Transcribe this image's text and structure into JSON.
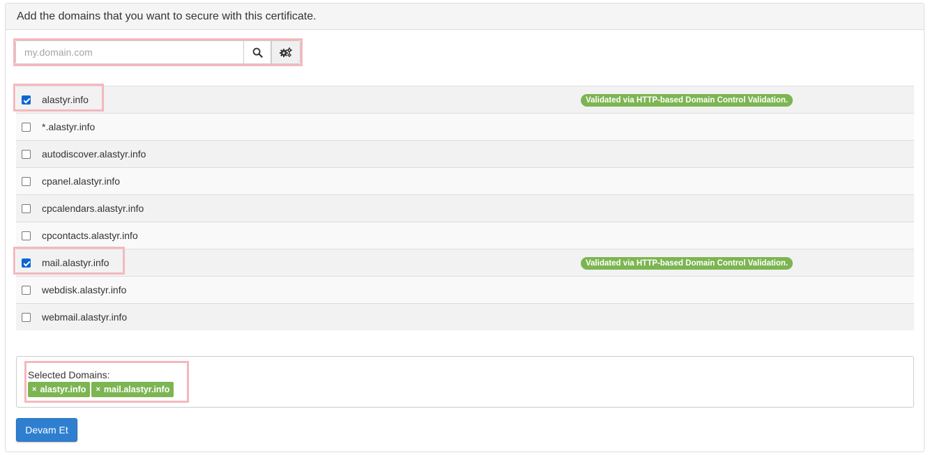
{
  "header": {
    "title": "Add the domains that you want to secure with this certificate."
  },
  "search": {
    "placeholder": "my.domain.com",
    "value": "",
    "search_icon": "search-icon",
    "settings_icon": "gears-icon"
  },
  "domains": [
    {
      "name": "alastyr.info",
      "checked": true,
      "validation": "Validated via HTTP-based Domain Control Validation."
    },
    {
      "name": "*.alastyr.info",
      "checked": false,
      "validation": ""
    },
    {
      "name": "autodiscover.alastyr.info",
      "checked": false,
      "validation": ""
    },
    {
      "name": "cpanel.alastyr.info",
      "checked": false,
      "validation": ""
    },
    {
      "name": "cpcalendars.alastyr.info",
      "checked": false,
      "validation": ""
    },
    {
      "name": "cpcontacts.alastyr.info",
      "checked": false,
      "validation": ""
    },
    {
      "name": "mail.alastyr.info",
      "checked": true,
      "validation": "Validated via HTTP-based Domain Control Validation."
    },
    {
      "name": "webdisk.alastyr.info",
      "checked": false,
      "validation": ""
    },
    {
      "name": "webmail.alastyr.info",
      "checked": false,
      "validation": ""
    }
  ],
  "selected": {
    "label": "Selected Domains:",
    "chips": [
      "alastyr.info",
      "mail.alastyr.info"
    ],
    "remove_symbol": "×"
  },
  "actions": {
    "continue_label": "Devam Et"
  },
  "colors": {
    "badge": "#7cb552",
    "primary_button": "#2f7fd0",
    "highlight": "#f4b8bd",
    "checkbox": "#0a66d4"
  }
}
